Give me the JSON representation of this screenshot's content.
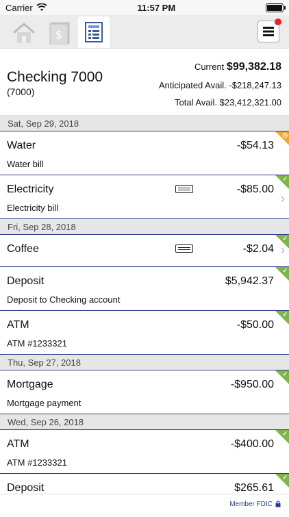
{
  "status": {
    "carrier": "Carrier",
    "time": "11:57 PM"
  },
  "account": {
    "name": "Checking 7000",
    "number": "(7000)"
  },
  "balances": {
    "current_label": "Current",
    "current_value": "$99,382.18",
    "anticipated_label": "Anticipated Avail.",
    "anticipated_value": "-$218,247.13",
    "total_label": "Total Avail.",
    "total_value": "$23,412,321.00"
  },
  "groups": [
    {
      "date": "Sat, Sep 29, 2018",
      "txns": [
        {
          "name": "Water",
          "amount": "-$54.13",
          "memo": "Water bill",
          "state": "pending"
        },
        {
          "name": "Electricity",
          "amount": "-$85.00",
          "memo": "Electricity bill",
          "state": "cleared"
        }
      ]
    },
    {
      "date": "Fri, Sep 28, 2018",
      "txns": [
        {
          "name": "Coffee",
          "amount": "-$2.04",
          "memo": "",
          "state": "cleared"
        },
        {
          "name": "Deposit",
          "amount": "$5,942.37",
          "memo": "Deposit to Checking account",
          "state": "cleared"
        },
        {
          "name": "ATM",
          "amount": "-$50.00",
          "memo": "ATM #1233321",
          "state": "cleared"
        }
      ]
    },
    {
      "date": "Thu, Sep 27, 2018",
      "txns": [
        {
          "name": "Mortgage",
          "amount": "-$950.00",
          "memo": "Mortgage payment",
          "state": "cleared"
        }
      ]
    },
    {
      "date": "Wed, Sep 26, 2018",
      "txns": [
        {
          "name": "ATM",
          "amount": "-$400.00",
          "memo": "ATM #1233321",
          "state": "cleared"
        },
        {
          "name": "Deposit",
          "amount": "$265.61",
          "memo": "",
          "state": "cleared"
        }
      ]
    }
  ],
  "footer": {
    "text": "Member FDIC"
  },
  "colors": {
    "accent": "#2a3990",
    "cleared": "#7ab648",
    "pending": "#f0a830"
  }
}
